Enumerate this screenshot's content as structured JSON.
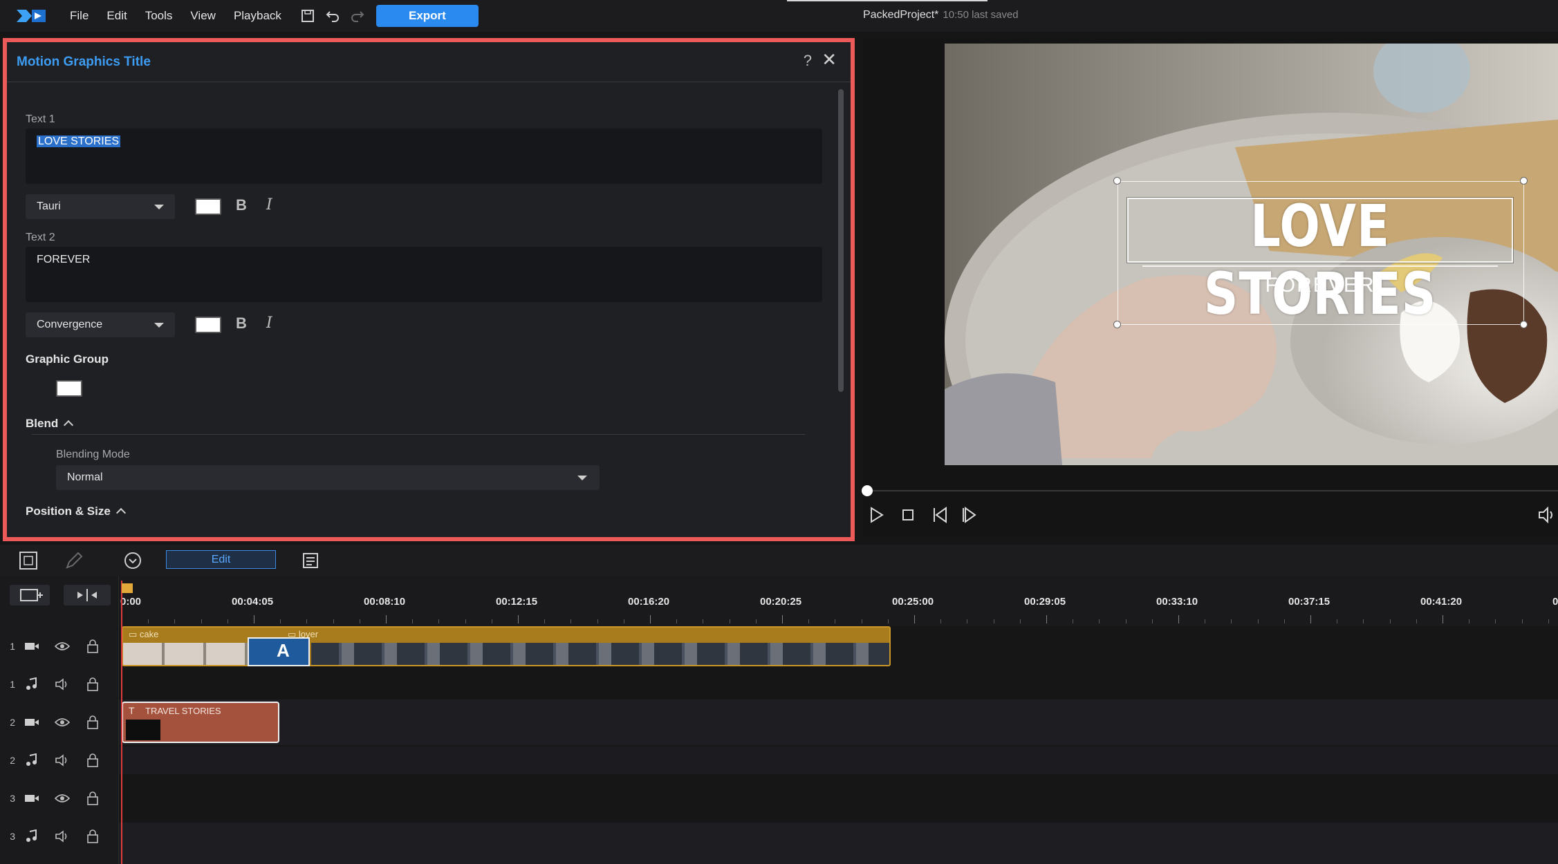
{
  "menu": {
    "items": [
      "File",
      "Edit",
      "Tools",
      "View",
      "Playback"
    ],
    "export_label": "Export",
    "project_name": "PackedProject*",
    "saved_status": "10:50 last saved"
  },
  "panel": {
    "title": "Motion Graphics Title",
    "help_glyph": "?",
    "close_glyph": "✕",
    "text1_label": "Text 1",
    "text1_value": "LOVE STORIES",
    "text1_font": "Tauri",
    "text2_label": "Text 2",
    "text2_value": "FOREVER",
    "text2_font": "Convergence",
    "bold_glyph": "B",
    "italic_glyph": "I",
    "graphic_group_label": "Graphic Group",
    "blend_label": "Blend",
    "blending_mode_label": "Blending Mode",
    "blending_mode_value": "Normal",
    "position_size_label": "Position & Size",
    "swatch_color": "#ffffff"
  },
  "preview": {
    "title_text": "LOVE STORIES",
    "subtitle_text": "FOREVER"
  },
  "timeline_toolbar": {
    "edit_label": "Edit"
  },
  "timeline": {
    "ruler_labels": [
      "0:00",
      "00:04:05",
      "00:08:10",
      "00:12:15",
      "00:16:20",
      "00:20:25",
      "00:25:00",
      "00:29:05",
      "00:33:10",
      "00:37:15",
      "00:41:20",
      "0"
    ],
    "tracks": [
      {
        "num": "1",
        "kind": "video"
      },
      {
        "num": "1",
        "kind": "audio"
      },
      {
        "num": "2",
        "kind": "video"
      },
      {
        "num": "2",
        "kind": "audio"
      },
      {
        "num": "3",
        "kind": "video"
      },
      {
        "num": "3",
        "kind": "audio"
      }
    ],
    "clips": {
      "cake": "cake",
      "lover": "lover",
      "transition": "A",
      "title_clip": "TRAVEL STORIES"
    }
  },
  "colors": {
    "accent": "#2b8af0",
    "panel_border": "#ec5a5a",
    "video_clip": "#a87c1c",
    "title_clip": "#a4523e"
  }
}
